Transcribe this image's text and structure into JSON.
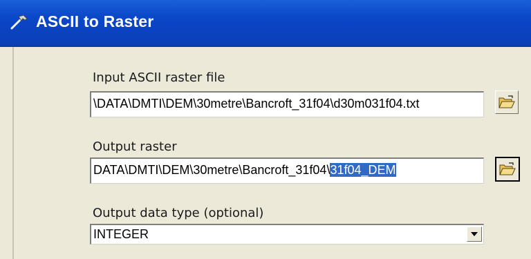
{
  "window": {
    "title": "ASCII to Raster",
    "title_icon": "hammer-icon"
  },
  "form": {
    "input_label": "Input ASCII raster file",
    "input_value": "\\DATA\\DMTI\\DEM\\30metre\\Bancroft_31f04\\d30m031f04.txt",
    "output_label": "Output raster",
    "output_value_prefix": "DATA\\DMTI\\DEM\\30metre\\Bancroft_31f04\\",
    "output_value_selected": "31f04_DEM",
    "datatype_label": "Output data type (optional)",
    "datatype_value": "INTEGER",
    "browse_icon": "open-folder-icon",
    "dropdown_icon": "chevron-down-icon"
  },
  "colors": {
    "titlebar": "#0a46c8",
    "panel": "#ede9d9",
    "selection": "#316ac5"
  }
}
